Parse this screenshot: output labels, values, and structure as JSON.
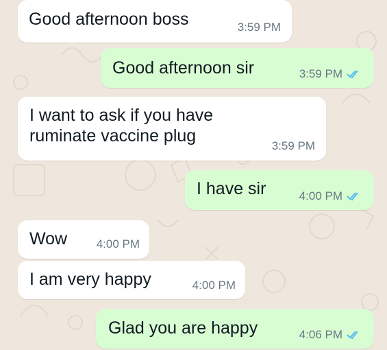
{
  "colors": {
    "incoming_bubble": "#ffffff",
    "outgoing_bubble": "#d9fdd3",
    "wallpaper": "#efe7dd",
    "timestamp": "#667781",
    "read_ticks": "#53bdeb"
  },
  "messages": [
    {
      "direction": "incoming",
      "text": "Good afternoon boss",
      "time": "3:59 PM"
    },
    {
      "direction": "outgoing",
      "text": "Good afternoon sir",
      "time": "3:59 PM",
      "status": "read"
    },
    {
      "direction": "incoming",
      "text": "I want to ask if you have\nruminate vaccine plug",
      "time": "3:59 PM"
    },
    {
      "direction": "outgoing",
      "text": "I have sir",
      "time": "4:00 PM",
      "status": "read"
    },
    {
      "direction": "incoming",
      "text": "Wow",
      "time": "4:00 PM"
    },
    {
      "direction": "incoming",
      "text": "I am very happy",
      "time": "4:00 PM"
    },
    {
      "direction": "outgoing",
      "text": "Glad you are happy",
      "time": "4:06 PM",
      "status": "read"
    }
  ]
}
